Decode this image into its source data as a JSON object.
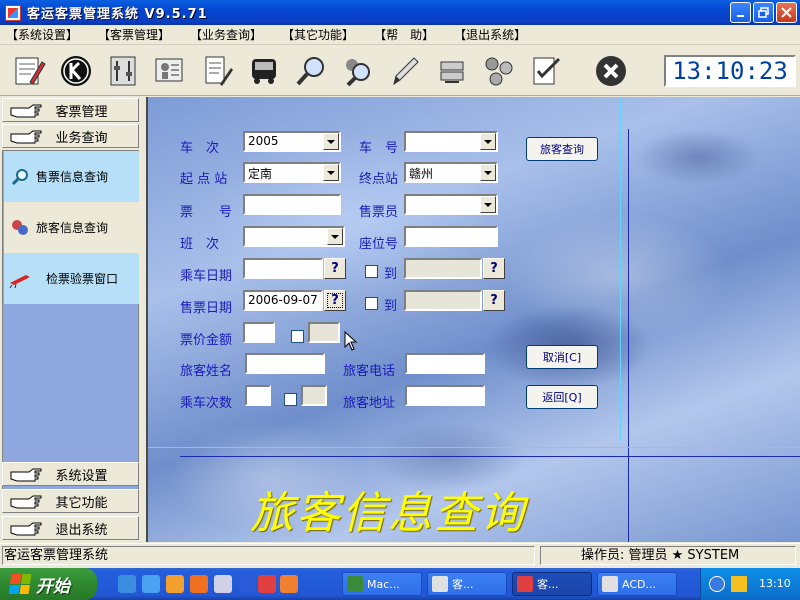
{
  "window": {
    "title": "客运客票管理系统 V9.5.71"
  },
  "menubar": [
    "【系统设置】",
    "【客票管理】",
    "【业务查询】",
    "【其它功能】",
    "【帮　助】",
    "【退出系统】"
  ],
  "toolbar": {
    "icons": [
      "map-edit-icon",
      "k-logo-icon",
      "settings-panel-icon",
      "info-board-icon",
      "notepad-icon",
      "bus-icon",
      "search-icon",
      "people-search-icon",
      "pen-icon",
      "server-icon",
      "network-icon",
      "checklist-icon",
      "exit-icon"
    ],
    "clock": "13:10:23"
  },
  "sidebar": {
    "top": [
      {
        "label": "客票管理"
      },
      {
        "label": "业务查询"
      }
    ],
    "sub": [
      {
        "label": "售票信息查询"
      },
      {
        "label": "旅客信息查询"
      },
      {
        "label": "检票验票窗口"
      }
    ],
    "bottom": [
      {
        "label": "系统设置"
      },
      {
        "label": "其它功能"
      },
      {
        "label": "退出系统"
      }
    ]
  },
  "form": {
    "labels": {
      "banci": "车　次",
      "chehao": "车　号",
      "qidian": "起 点 站",
      "zhongdian": "终点站",
      "piaohao": "票　　号",
      "shoupiaoyuan": "售票员",
      "banci2": "班　次",
      "zuowei": "座位号",
      "chengche": "乘车日期",
      "dao": "到",
      "shoupiao_date": "售票日期",
      "piaojia": "票价金额",
      "xingming": "旅客姓名",
      "dianhua": "旅客电话",
      "cishu": "乘车次数",
      "dizhi": "旅客地址"
    },
    "values": {
      "banci": "2005",
      "chehao": "",
      "qidian": "定南",
      "zhongdian": "赣州",
      "piaohao": "",
      "shoupiaoyuan": "",
      "banci2": "",
      "zuowei": "",
      "chengche": "",
      "shoupiao_date": "2006-09-07"
    },
    "buttons": {
      "query": "旅客查询",
      "cancel": "取消[C]",
      "back": "返回[Q]",
      "help": "?"
    },
    "big_title": "旅客信息查询"
  },
  "statusbar": {
    "left": "客运客票管理系统",
    "right": "操作员: 管理员 ★ SYSTEM"
  },
  "taskbar": {
    "start": "开始",
    "tasks": [
      {
        "label": "Mac..."
      },
      {
        "label": "客..."
      },
      {
        "label": "客..."
      },
      {
        "label": "ACD..."
      }
    ],
    "time": "13:10"
  }
}
